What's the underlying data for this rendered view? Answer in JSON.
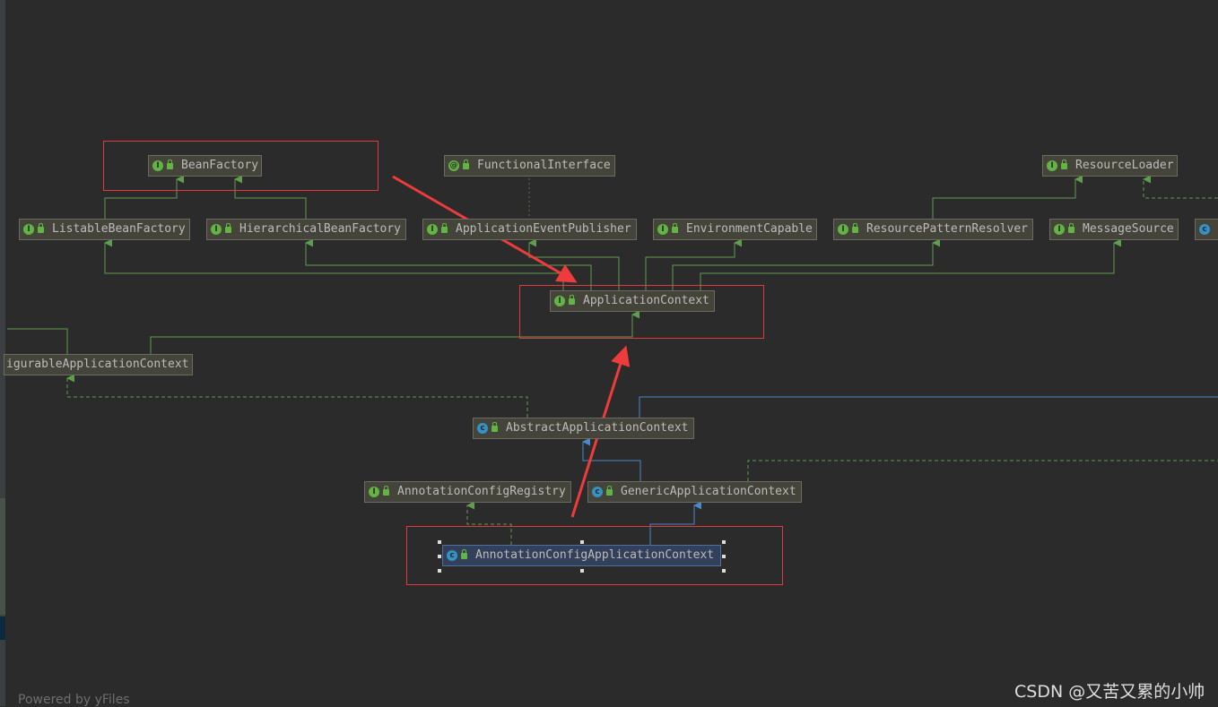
{
  "diagram": {
    "nodes": {
      "bean_factory": {
        "label": "BeanFactory",
        "kind": "interface"
      },
      "functional_interface": {
        "label": "FunctionalInterface",
        "kind": "annotation"
      },
      "resource_loader": {
        "label": "ResourceLoader",
        "kind": "interface"
      },
      "listable_bean_factory": {
        "label": "ListableBeanFactory",
        "kind": "interface"
      },
      "hierarchical_bean_factory": {
        "label": "HierarchicalBeanFactory",
        "kind": "interface"
      },
      "application_event_publisher": {
        "label": "ApplicationEventPublisher",
        "kind": "interface"
      },
      "environment_capable": {
        "label": "EnvironmentCapable",
        "kind": "interface"
      },
      "resource_pattern_resolver": {
        "label": "ResourcePatternResolver",
        "kind": "interface"
      },
      "message_source": {
        "label": "MessageSource",
        "kind": "interface"
      },
      "application_context": {
        "label": "ApplicationContext",
        "kind": "interface"
      },
      "configurable_application_context": {
        "label": "igurableApplicationContext",
        "kind": "interface"
      },
      "abstract_application_context": {
        "label": "AbstractApplicationContext",
        "kind": "abstract-class"
      },
      "annotation_config_registry": {
        "label": "AnnotationConfigRegistry",
        "kind": "interface"
      },
      "generic_application_context": {
        "label": "GenericApplicationContext",
        "kind": "class"
      },
      "annotation_config_application_context": {
        "label": "AnnotationConfigApplicationContext",
        "kind": "class",
        "selected": true
      }
    },
    "colors": {
      "background": "#2b2b2b",
      "interface_edge": "#5f9e4f",
      "class_edge": "#4a88c7",
      "annotation_edge": "#5e6e55",
      "highlight": "#e0393e"
    }
  },
  "footer": {
    "text": "Powered by yFiles"
  },
  "watermark": {
    "text": "CSDN @又苦又累的小帅"
  }
}
